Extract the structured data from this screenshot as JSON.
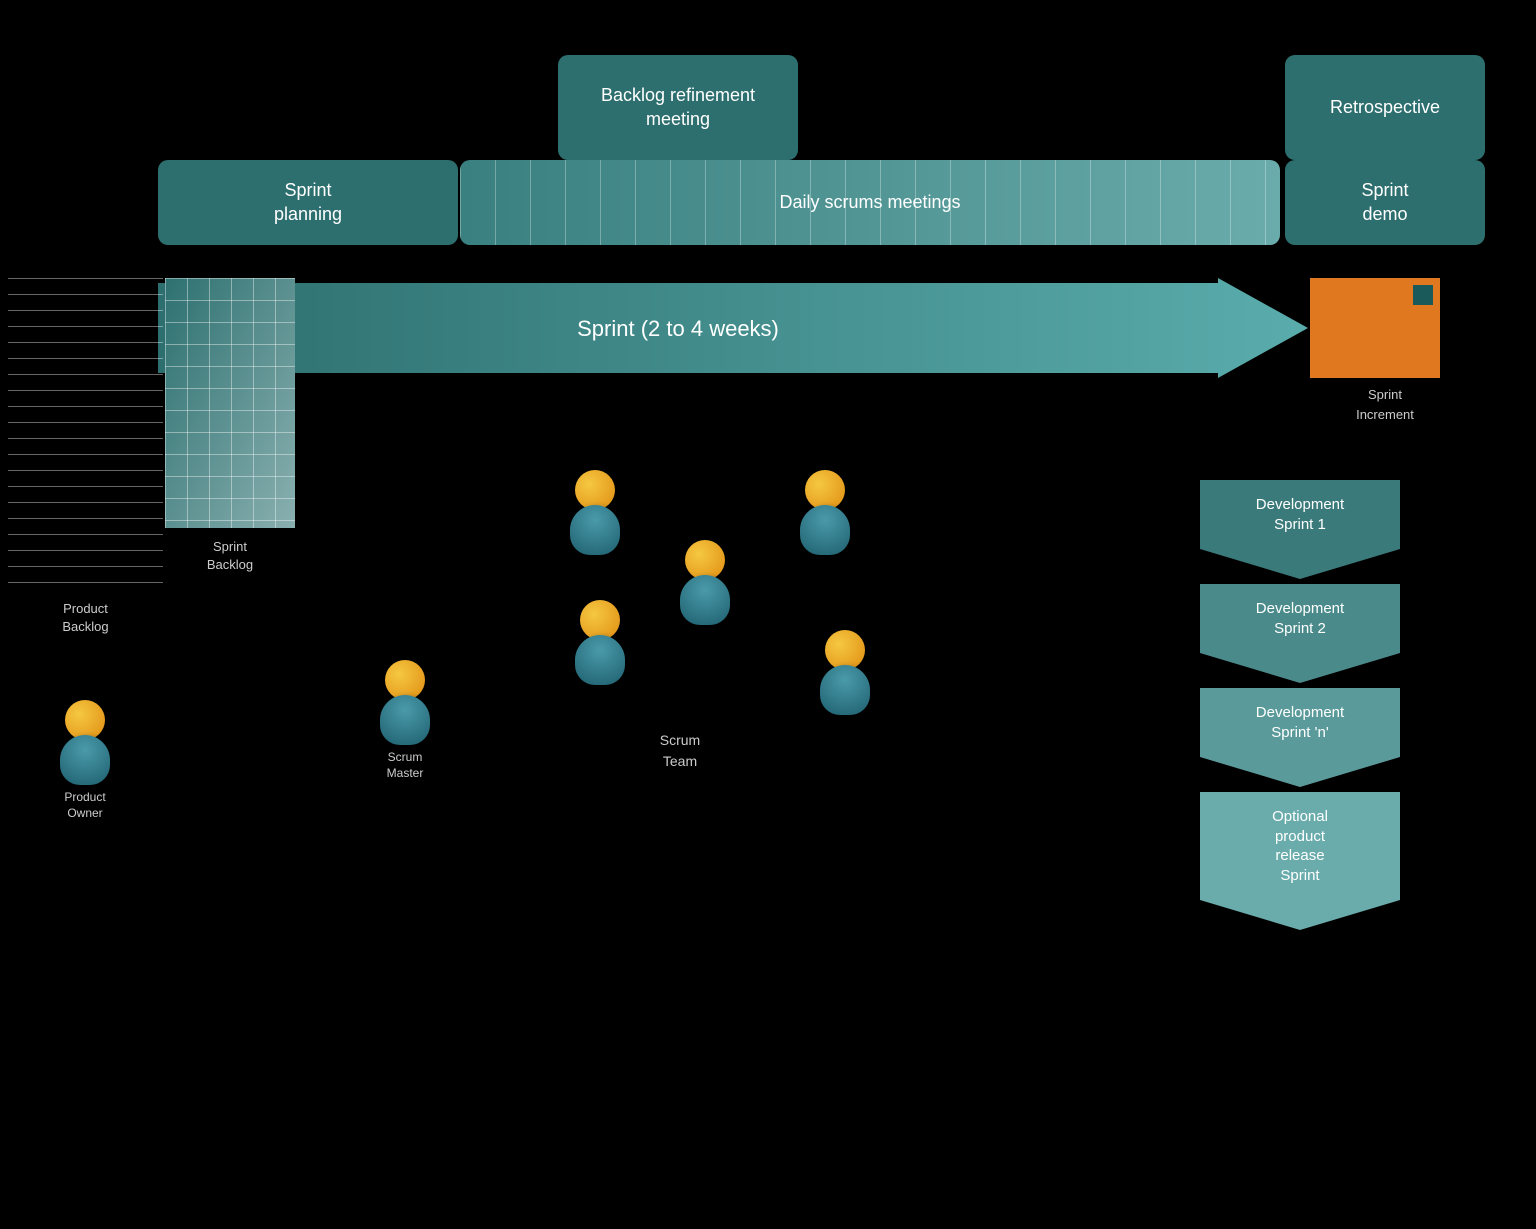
{
  "header": {
    "backlog_refinement": "Backlog refinement\nmeeting",
    "retrospective": "Retrospective",
    "sprint_planning": "Sprint\nplanning",
    "daily_scrums": "Daily scrums meetings",
    "sprint_demo": "Sprint\ndemo"
  },
  "sprint_arrow": {
    "label": "Sprint (2 to 4 weeks)"
  },
  "labels": {
    "product_backlog": "Product\nBacklog",
    "sprint_backlog": "Sprint\nBacklog",
    "sprint_increment": "Sprint\nIncrement",
    "scrum_team": "Scrum\nTeam",
    "scrum_master": "Scrum\nMaster",
    "product_owner": "Product\nOwner"
  },
  "flow": {
    "sprint1": "Development\nSprint 1",
    "sprint2": "Development\nSprint 2",
    "sprintn": "Development\nSprint 'n'",
    "release": "Optional\nproduct\nrelease\nSprint"
  },
  "colors": {
    "teal_dark": "#2d6e6e",
    "teal_mid": "#3a8080",
    "orange": "#e07820",
    "arrow_color": "#4a9aaa",
    "text_light": "#cccccc",
    "bg": "#000000"
  }
}
